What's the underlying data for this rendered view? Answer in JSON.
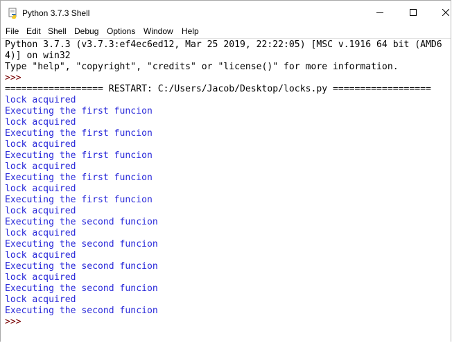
{
  "window": {
    "title": "Python 3.7.3 Shell",
    "icon": "python-idle-icon"
  },
  "controls": {
    "minimize": "−",
    "maximize": "☐",
    "close": "✕"
  },
  "menu": [
    "File",
    "Edit",
    "Shell",
    "Debug",
    "Options",
    "Window",
    "Help"
  ],
  "colors": {
    "output_text": "#000000",
    "prompt": "#770000",
    "stdout": "#2828d9"
  },
  "shell": {
    "lines": [
      {
        "text": "Python 3.7.3 (v3.7.3:ef4ec6ed12, Mar 25 2019, 22:22:05) [MSC v.1916 64 bit (AMD6",
        "kind": "out"
      },
      {
        "text": "4)] on win32",
        "kind": "out"
      },
      {
        "text": "Type \"help\", \"copyright\", \"credits\" or \"license()\" for more information.",
        "kind": "out"
      },
      {
        "text": ">>> ",
        "kind": "prompt"
      },
      {
        "text": "================== RESTART: C:/Users/Jacob/Desktop/locks.py ==================",
        "kind": "out"
      },
      {
        "text": "lock acquired",
        "kind": "stdout"
      },
      {
        "text": "Executing the first funcion",
        "kind": "stdout"
      },
      {
        "text": "lock acquired",
        "kind": "stdout"
      },
      {
        "text": "Executing the first funcion",
        "kind": "stdout"
      },
      {
        "text": "lock acquired",
        "kind": "stdout"
      },
      {
        "text": "Executing the first funcion",
        "kind": "stdout"
      },
      {
        "text": "lock acquired",
        "kind": "stdout"
      },
      {
        "text": "Executing the first funcion",
        "kind": "stdout"
      },
      {
        "text": "lock acquired",
        "kind": "stdout"
      },
      {
        "text": "Executing the first funcion",
        "kind": "stdout"
      },
      {
        "text": "lock acquired",
        "kind": "stdout"
      },
      {
        "text": "Executing the second funcion",
        "kind": "stdout"
      },
      {
        "text": "lock acquired",
        "kind": "stdout"
      },
      {
        "text": "Executing the second funcion",
        "kind": "stdout"
      },
      {
        "text": "lock acquired",
        "kind": "stdout"
      },
      {
        "text": "Executing the second funcion",
        "kind": "stdout"
      },
      {
        "text": "lock acquired",
        "kind": "stdout"
      },
      {
        "text": "Executing the second funcion",
        "kind": "stdout"
      },
      {
        "text": "lock acquired",
        "kind": "stdout"
      },
      {
        "text": "Executing the second funcion",
        "kind": "stdout"
      },
      {
        "text": ">>> ",
        "kind": "prompt"
      }
    ]
  }
}
